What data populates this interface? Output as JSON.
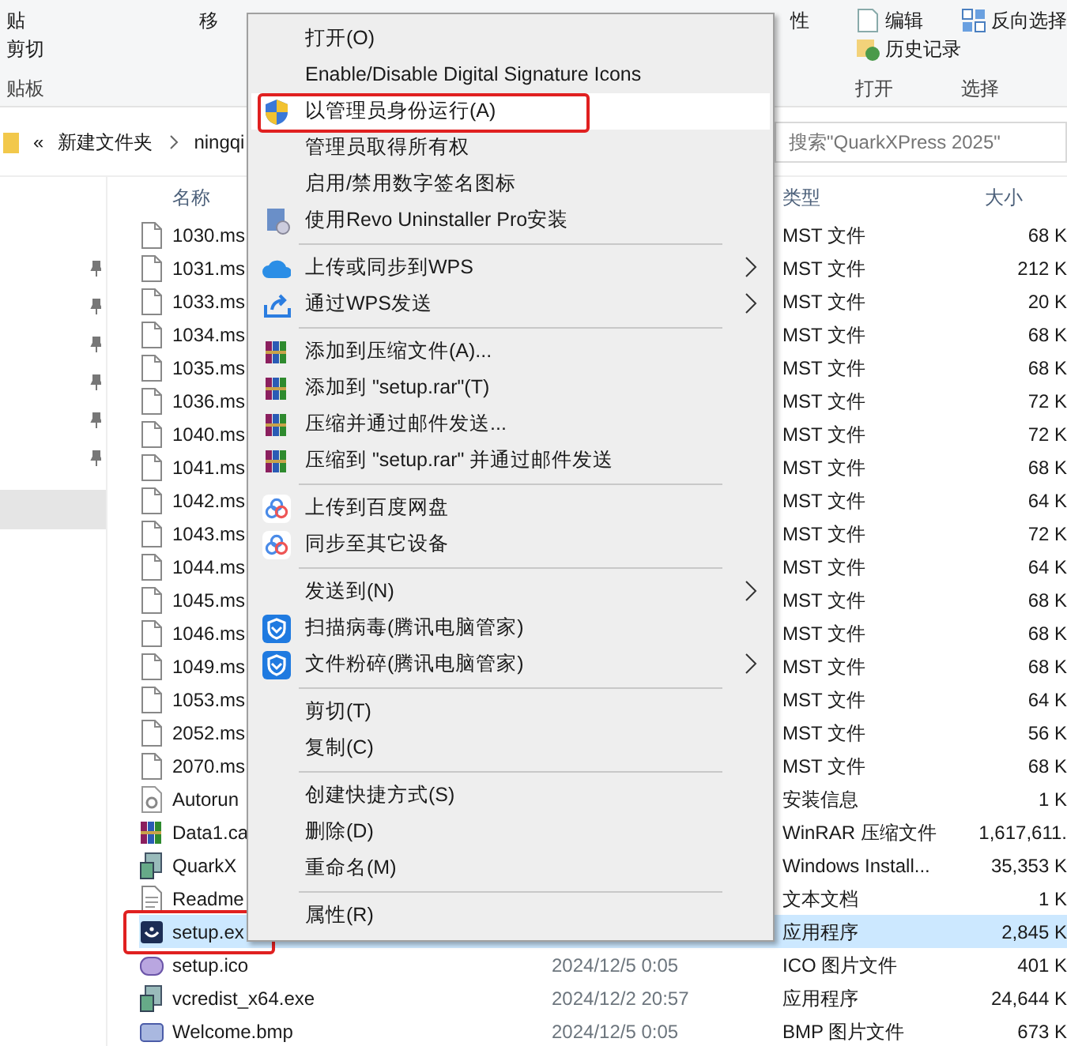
{
  "ribbon": {
    "groups": [
      {
        "items": [
          "贴",
          "剪切"
        ],
        "label": "贴板"
      },
      {
        "items": [
          "移"
        ]
      },
      {
        "items": [
          "性"
        ]
      },
      {
        "items": [
          "编辑",
          "历史记录"
        ],
        "label": "打开"
      },
      {
        "items": [
          "反向选择"
        ],
        "label": "选择"
      }
    ]
  },
  "address": {
    "overflow": "«",
    "crumbs": [
      "新建文件夹",
      "ningqi"
    ]
  },
  "search": {
    "placeholder": "搜索\"QuarkXPress 2025\""
  },
  "nav": {
    "selected_row": true
  },
  "table": {
    "columns": [
      "名称",
      "类型",
      "大小"
    ],
    "rows": [
      {
        "name": "1030.ms",
        "type": "MST 文件",
        "size": "68 K",
        "kind": "file",
        "selected": false,
        "highlighted": false
      },
      {
        "name": "1031.ms",
        "type": "MST 文件",
        "size": "212 K",
        "kind": "file",
        "selected": false,
        "highlighted": false
      },
      {
        "name": "1033.ms",
        "type": "MST 文件",
        "size": "20 K",
        "kind": "file",
        "selected": false,
        "highlighted": false
      },
      {
        "name": "1034.ms",
        "type": "MST 文件",
        "size": "68 K",
        "kind": "file",
        "selected": false,
        "highlighted": false
      },
      {
        "name": "1035.ms",
        "type": "MST 文件",
        "size": "68 K",
        "kind": "file",
        "selected": false,
        "highlighted": false
      },
      {
        "name": "1036.ms",
        "type": "MST 文件",
        "size": "72 K",
        "kind": "file",
        "selected": false,
        "highlighted": false
      },
      {
        "name": "1040.ms",
        "type": "MST 文件",
        "size": "72 K",
        "kind": "file",
        "selected": false,
        "highlighted": false
      },
      {
        "name": "1041.ms",
        "type": "MST 文件",
        "size": "68 K",
        "kind": "file",
        "selected": false,
        "highlighted": false
      },
      {
        "name": "1042.ms",
        "type": "MST 文件",
        "size": "64 K",
        "kind": "file",
        "selected": false,
        "highlighted": false
      },
      {
        "name": "1043.ms",
        "type": "MST 文件",
        "size": "72 K",
        "kind": "file",
        "selected": false,
        "highlighted": false
      },
      {
        "name": "1044.ms",
        "type": "MST 文件",
        "size": "64 K",
        "kind": "file",
        "selected": false,
        "highlighted": false
      },
      {
        "name": "1045.ms",
        "type": "MST 文件",
        "size": "68 K",
        "kind": "file",
        "selected": false,
        "highlighted": false
      },
      {
        "name": "1046.ms",
        "type": "MST 文件",
        "size": "68 K",
        "kind": "file",
        "selected": false,
        "highlighted": false
      },
      {
        "name": "1049.ms",
        "type": "MST 文件",
        "size": "68 K",
        "kind": "file",
        "selected": false,
        "highlighted": false
      },
      {
        "name": "1053.ms",
        "type": "MST 文件",
        "size": "64 K",
        "kind": "file",
        "selected": false,
        "highlighted": false
      },
      {
        "name": "2052.ms",
        "type": "MST 文件",
        "size": "56 K",
        "kind": "file",
        "selected": false,
        "highlighted": false
      },
      {
        "name": "2070.ms",
        "type": "MST 文件",
        "size": "68 K",
        "kind": "file",
        "selected": false,
        "highlighted": false
      },
      {
        "name": "Autorun",
        "type": "安装信息",
        "size": "1 K",
        "kind": "setup-info",
        "selected": false,
        "highlighted": false
      },
      {
        "name": "Data1.ca",
        "type": "WinRAR 压缩文件",
        "size": "1,617,611.",
        "kind": "archive",
        "selected": false,
        "highlighted": false
      },
      {
        "name": "QuarkX",
        "type": "Windows Install...",
        "size": "35,353 K",
        "kind": "installer",
        "selected": false,
        "highlighted": false
      },
      {
        "name": "Readme",
        "type": "文本文档",
        "size": "1 K",
        "kind": "text",
        "selected": false,
        "highlighted": false
      },
      {
        "name": "setup.ex",
        "type": "应用程序",
        "size": "2,845 K",
        "kind": "app",
        "selected": true,
        "highlighted": true
      },
      {
        "name": "setup.ico",
        "date": "2024/12/5 0:05",
        "type": "ICO 图片文件",
        "size": "401 K",
        "kind": "ico",
        "selected": false,
        "highlighted": false
      },
      {
        "name": "vcredist_x64.exe",
        "date": "2024/12/2 20:57",
        "type": "应用程序",
        "size": "24,644 K",
        "kind": "installer",
        "selected": false,
        "highlighted": false
      },
      {
        "name": "Welcome.bmp",
        "date": "2024/12/5 0:05",
        "type": "BMP 图片文件",
        "size": "673 K",
        "kind": "bmp",
        "selected": false,
        "highlighted": false
      }
    ]
  },
  "context_menu": {
    "items": [
      {
        "kind": "plain",
        "label": "打开(O)",
        "submenu": false,
        "hovered": false,
        "highlighted": false
      },
      {
        "kind": "plain",
        "label": "Enable/Disable Digital Signature Icons",
        "submenu": false,
        "hovered": false,
        "highlighted": false
      },
      {
        "kind": "shield",
        "label": "以管理员身份运行(A)",
        "submenu": false,
        "hovered": true,
        "highlighted": true
      },
      {
        "kind": "plain",
        "label": "管理员取得所有权",
        "submenu": false,
        "hovered": false,
        "highlighted": false
      },
      {
        "kind": "plain",
        "label": "启用/禁用数字签名图标",
        "submenu": false,
        "hovered": false,
        "highlighted": false
      },
      {
        "kind": "revo",
        "label": "使用Revo Uninstaller Pro安装",
        "submenu": false,
        "hovered": false,
        "highlighted": false
      },
      {
        "kind": "separator"
      },
      {
        "kind": "cloud",
        "label": "上传或同步到WPS",
        "submenu": true,
        "hovered": false,
        "highlighted": false
      },
      {
        "kind": "share",
        "label": "通过WPS发送",
        "submenu": true,
        "hovered": false,
        "highlighted": false
      },
      {
        "kind": "separator"
      },
      {
        "kind": "archive",
        "label": "添加到压缩文件(A)...",
        "submenu": false,
        "hovered": false,
        "highlighted": false
      },
      {
        "kind": "archive",
        "label": "添加到 \"setup.rar\"(T)",
        "submenu": false,
        "hovered": false,
        "highlighted": false
      },
      {
        "kind": "archive",
        "label": "压缩并通过邮件发送...",
        "submenu": false,
        "hovered": false,
        "highlighted": false
      },
      {
        "kind": "archive",
        "label": "压缩到 \"setup.rar\" 并通过邮件发送",
        "submenu": false,
        "hovered": false,
        "highlighted": false
      },
      {
        "kind": "separator"
      },
      {
        "kind": "rings",
        "label": "上传到百度网盘",
        "submenu": false,
        "hovered": false,
        "highlighted": false
      },
      {
        "kind": "rings",
        "label": "同步至其它设备",
        "submenu": false,
        "hovered": false,
        "highlighted": false
      },
      {
        "kind": "separator"
      },
      {
        "kind": "plain",
        "label": "发送到(N)",
        "submenu": true,
        "hovered": false,
        "highlighted": false
      },
      {
        "kind": "guard",
        "label": "扫描病毒(腾讯电脑管家)",
        "submenu": false,
        "hovered": false,
        "highlighted": false
      },
      {
        "kind": "guard",
        "label": "文件粉碎(腾讯电脑管家)",
        "submenu": true,
        "hovered": false,
        "highlighted": false
      },
      {
        "kind": "separator"
      },
      {
        "kind": "plain",
        "label": "剪切(T)",
        "submenu": false,
        "hovered": false,
        "highlighted": false
      },
      {
        "kind": "plain",
        "label": "复制(C)",
        "submenu": false,
        "hovered": false,
        "highlighted": false
      },
      {
        "kind": "separator"
      },
      {
        "kind": "plain",
        "label": "创建快捷方式(S)",
        "submenu": false,
        "hovered": false,
        "highlighted": false
      },
      {
        "kind": "plain",
        "label": "删除(D)",
        "submenu": false,
        "hovered": false,
        "highlighted": false
      },
      {
        "kind": "plain",
        "label": "重命名(M)",
        "submenu": false,
        "hovered": false,
        "highlighted": false
      },
      {
        "kind": "separator"
      },
      {
        "kind": "plain",
        "label": "属性(R)",
        "submenu": false,
        "hovered": false,
        "highlighted": false
      }
    ]
  }
}
